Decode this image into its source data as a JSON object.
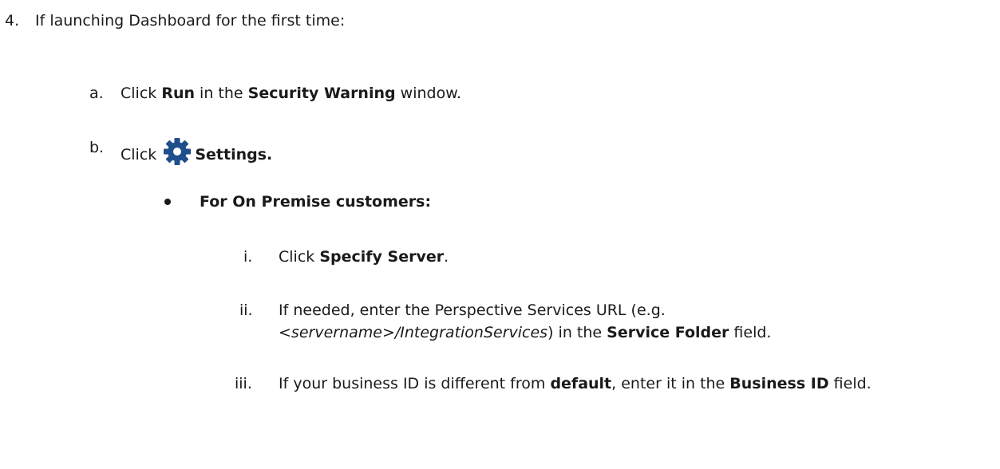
{
  "step4": {
    "marker": "4.",
    "text": "If launching Dashboard for the first time:"
  },
  "step_a": {
    "marker": "a.",
    "pre": "Click ",
    "bold1": "Run",
    "mid": " in the ",
    "bold2": "Security Warning",
    "post": " window."
  },
  "step_b": {
    "marker": "b.",
    "pre": "Click ",
    "icon": "gear-icon",
    "bold": "Settings."
  },
  "bullet_item": {
    "bold": "For On Premise customers:"
  },
  "step_i": {
    "marker": "i.",
    "pre": "Click ",
    "bold": "Specify Server",
    "post": "."
  },
  "step_ii": {
    "marker": "ii.",
    "line1": "If needed, enter the Perspective Services URL (e.g.",
    "italic": "<servername>/IntegrationServices",
    "mid": ") in the ",
    "bold": "Service Folder",
    "post": " field."
  },
  "step_iii": {
    "marker": "iii.",
    "pre": "If your business ID is different from ",
    "bold1": "default",
    "mid": ", enter it in the ",
    "bold2": "Business ID",
    "post": " field."
  },
  "colors": {
    "text": "#1a1a1a",
    "icon": "#1f4e8c"
  }
}
